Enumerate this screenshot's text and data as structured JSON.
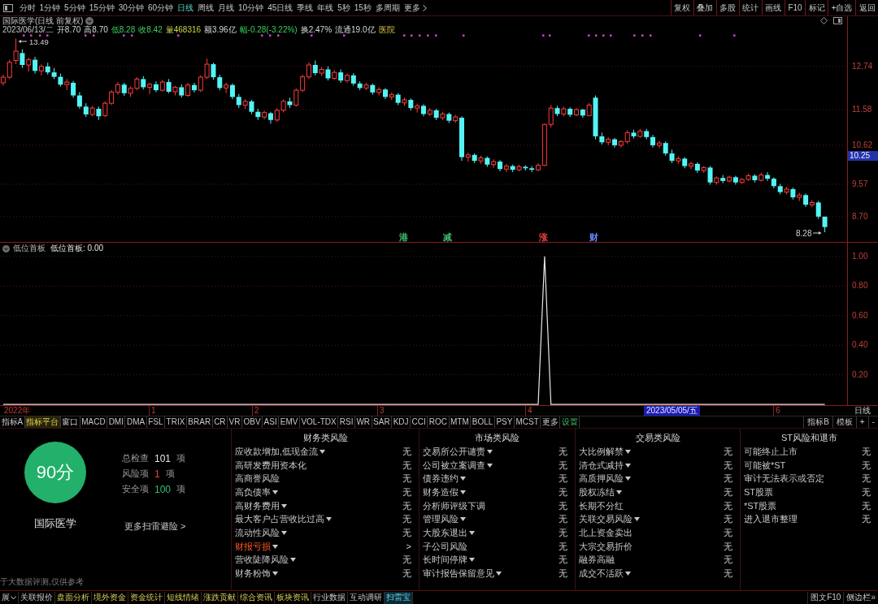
{
  "toolbar": {
    "periods": [
      {
        "label": "分时",
        "selected": false
      },
      {
        "label": "1分钟",
        "selected": false
      },
      {
        "label": "5分钟",
        "selected": false
      },
      {
        "label": "15分钟",
        "selected": false
      },
      {
        "label": "30分钟",
        "selected": false
      },
      {
        "label": "60分钟",
        "selected": false
      },
      {
        "label": "日线",
        "selected": true
      },
      {
        "label": "周线",
        "selected": false
      },
      {
        "label": "月线",
        "selected": false
      },
      {
        "label": "10分钟",
        "selected": false
      },
      {
        "label": "45日线",
        "selected": false
      },
      {
        "label": "季线",
        "selected": false
      },
      {
        "label": "年线",
        "selected": false
      },
      {
        "label": "5秒",
        "selected": false
      },
      {
        "label": "15秒",
        "selected": false
      },
      {
        "label": "多周期",
        "selected": false
      }
    ],
    "more": "更多",
    "actions": [
      "复权",
      "叠加",
      "多股",
      "统计",
      "画线",
      "F10",
      "标记",
      "+自选",
      "返回"
    ]
  },
  "quote": {
    "title": "国际医学(日线 前复权)",
    "date": "2023/06/13/二",
    "fields": [
      {
        "label": "开",
        "value": "8.70",
        "kind": "plain"
      },
      {
        "label": "高",
        "value": "8.70",
        "kind": "plain"
      },
      {
        "label": "低",
        "value": "8.28",
        "kind": "down"
      },
      {
        "label": "收",
        "value": "8.42",
        "kind": "down"
      },
      {
        "label": "量",
        "value": "468316",
        "kind": "volume"
      },
      {
        "label": "额",
        "value": "3.96亿",
        "kind": "plain"
      },
      {
        "label": "幅",
        "value": "-0.28(-3.22%)",
        "kind": "down"
      },
      {
        "label": "换",
        "value": "2.47%",
        "kind": "plain"
      },
      {
        "label": "流通",
        "value": "19.0亿",
        "kind": "plain"
      }
    ],
    "industry": "医院"
  },
  "price_chart": {
    "cursor_price": "10.25",
    "high_label": "13.49",
    "low_label": "8.28",
    "events": [
      {
        "label": "港",
        "color": "#3dbb6a"
      },
      {
        "label": "减",
        "color": "#3dbb6a"
      },
      {
        "label": "涨",
        "color": "#e84040"
      },
      {
        "label": "财",
        "color": "#6a8cff"
      }
    ],
    "chart_data": {
      "type": "candlestick",
      "grid": true,
      "ylim": [
        8.02,
        14.09
      ],
      "yticks": [
        {
          "value": 12.74,
          "label": "12.74"
        },
        {
          "value": 11.58,
          "label": "11.58"
        },
        {
          "value": 10.62,
          "label": "10.62"
        },
        {
          "value": 9.57,
          "label": "9.57"
        },
        {
          "value": 8.7,
          "label": "8.70"
        }
      ],
      "categories": [
        null,
        null,
        null,
        null,
        null,
        null,
        null,
        null,
        null,
        null,
        null,
        null,
        null,
        null,
        null,
        null,
        null,
        null,
        null,
        null,
        null,
        null,
        null,
        null,
        null,
        null,
        null,
        null,
        null,
        null,
        null,
        null,
        null,
        null,
        null,
        null,
        null,
        null,
        null,
        null,
        null,
        null,
        null,
        null,
        null,
        null,
        null,
        null,
        null,
        null,
        null,
        null,
        null,
        null,
        null,
        null,
        null,
        null,
        null,
        null,
        null,
        null,
        null,
        null,
        null,
        null,
        null,
        null,
        null,
        null,
        null,
        null,
        null,
        null,
        null,
        null,
        null,
        null,
        null,
        null,
        null,
        null,
        null,
        null,
        null,
        null,
        null,
        null,
        null,
        null,
        null,
        null,
        null,
        null,
        null,
        null,
        null,
        null,
        null,
        null,
        null,
        null,
        null,
        null,
        null,
        null,
        null,
        null,
        null,
        null,
        null,
        null,
        null,
        null,
        null,
        null,
        null,
        null,
        null,
        null,
        null,
        null,
        null,
        null,
        null,
        null,
        null,
        null,
        null,
        null,
        null,
        null,
        null
      ],
      "ohlc": [
        [
          12.3,
          12.52,
          12.22,
          12.45
        ],
        [
          12.45,
          12.92,
          12.4,
          12.85
        ],
        [
          12.9,
          13.49,
          12.8,
          13.15
        ],
        [
          13.1,
          13.2,
          12.7,
          12.78
        ],
        [
          12.78,
          12.98,
          12.6,
          12.92
        ],
        [
          12.92,
          13.0,
          12.55,
          12.62
        ],
        [
          12.62,
          12.8,
          12.5,
          12.74
        ],
        [
          12.74,
          12.84,
          12.52,
          12.58
        ],
        [
          12.58,
          12.7,
          12.4,
          12.46
        ],
        [
          12.46,
          12.55,
          12.2,
          12.25
        ],
        [
          12.25,
          12.4,
          12.1,
          12.32
        ],
        [
          12.3,
          12.35,
          11.9,
          11.96
        ],
        [
          11.96,
          12.05,
          11.6,
          11.66
        ],
        [
          11.66,
          11.75,
          11.38,
          11.45
        ],
        [
          11.45,
          11.68,
          11.4,
          11.62
        ],
        [
          11.6,
          11.66,
          11.3,
          11.4
        ],
        [
          11.42,
          11.8,
          11.38,
          11.75
        ],
        [
          11.75,
          12.1,
          11.7,
          12.05
        ],
        [
          12.05,
          12.32,
          11.98,
          12.25
        ],
        [
          12.25,
          12.3,
          11.95,
          12.02
        ],
        [
          12.02,
          12.2,
          11.92,
          12.15
        ],
        [
          12.15,
          12.45,
          12.1,
          12.4
        ],
        [
          12.4,
          12.48,
          12.12,
          12.18
        ],
        [
          12.18,
          12.3,
          12.0,
          12.26
        ],
        [
          12.26,
          12.34,
          12.05,
          12.1
        ],
        [
          12.1,
          12.38,
          12.06,
          12.32
        ],
        [
          12.32,
          12.4,
          12.02,
          12.06
        ],
        [
          12.06,
          12.22,
          11.96,
          12.18
        ],
        [
          12.18,
          12.26,
          11.9,
          11.96
        ],
        [
          11.96,
          12.3,
          11.92,
          12.24
        ],
        [
          12.24,
          12.3,
          12.04,
          12.1
        ],
        [
          12.1,
          12.5,
          12.05,
          12.45
        ],
        [
          12.45,
          12.95,
          12.4,
          12.8
        ],
        [
          12.8,
          12.84,
          12.38,
          12.45
        ],
        [
          12.45,
          12.52,
          12.1,
          12.16
        ],
        [
          12.16,
          12.3,
          12.02,
          12.24
        ],
        [
          12.24,
          12.28,
          11.86,
          11.92
        ],
        [
          11.92,
          12.0,
          11.62,
          11.7
        ],
        [
          11.7,
          11.86,
          11.6,
          11.8
        ],
        [
          11.8,
          11.84,
          11.46,
          11.52
        ],
        [
          11.52,
          11.6,
          11.3,
          11.38
        ],
        [
          11.38,
          11.55,
          11.32,
          11.5
        ],
        [
          11.48,
          11.52,
          11.2,
          11.3
        ],
        [
          11.3,
          11.62,
          11.25,
          11.56
        ],
        [
          11.56,
          11.85,
          11.5,
          11.8
        ],
        [
          11.8,
          11.9,
          11.62,
          11.7
        ],
        [
          11.7,
          12.15,
          11.66,
          12.1
        ],
        [
          12.1,
          12.52,
          12.05,
          12.46
        ],
        [
          12.46,
          12.85,
          12.4,
          12.78
        ],
        [
          12.78,
          12.9,
          12.5,
          12.56
        ],
        [
          12.56,
          12.72,
          12.48,
          12.66
        ],
        [
          12.66,
          12.74,
          12.36,
          12.42
        ],
        [
          12.42,
          12.64,
          12.38,
          12.58
        ],
        [
          12.58,
          12.66,
          12.3,
          12.36
        ],
        [
          12.36,
          12.55,
          12.3,
          12.5
        ],
        [
          12.5,
          12.56,
          12.22,
          12.28
        ],
        [
          12.28,
          12.34,
          12.1,
          12.16
        ],
        [
          12.16,
          12.3,
          12.1,
          12.24
        ],
        [
          12.24,
          12.28,
          11.98,
          12.04
        ],
        [
          12.04,
          12.18,
          11.96,
          12.12
        ],
        [
          12.12,
          12.16,
          11.86,
          11.92
        ],
        [
          11.92,
          12.04,
          11.84,
          11.98
        ],
        [
          11.98,
          12.02,
          11.7,
          11.76
        ],
        [
          11.76,
          11.9,
          11.68,
          11.84
        ],
        [
          11.84,
          11.88,
          11.56,
          11.62
        ],
        [
          11.62,
          11.74,
          11.5,
          11.68
        ],
        [
          11.68,
          11.72,
          11.4,
          11.46
        ],
        [
          11.46,
          11.62,
          11.4,
          11.56
        ],
        [
          11.56,
          11.6,
          11.3,
          11.36
        ],
        [
          11.36,
          11.52,
          11.3,
          11.46
        ],
        [
          11.46,
          11.5,
          11.22,
          11.28
        ],
        [
          11.28,
          11.44,
          11.22,
          11.38
        ],
        [
          11.36,
          11.4,
          10.2,
          10.3
        ],
        [
          10.3,
          10.42,
          10.18,
          10.36
        ],
        [
          10.36,
          10.4,
          10.14,
          10.2
        ],
        [
          10.2,
          10.34,
          10.12,
          10.28
        ],
        [
          10.28,
          10.32,
          10.04,
          10.1
        ],
        [
          10.1,
          10.24,
          10.02,
          10.18
        ],
        [
          10.18,
          10.22,
          9.92,
          9.98
        ],
        [
          9.98,
          10.12,
          9.9,
          10.06
        ],
        [
          10.06,
          10.1,
          9.9,
          9.96
        ],
        [
          9.96,
          10.1,
          9.92,
          10.04
        ],
        [
          10.04,
          10.08,
          9.94,
          10.0
        ],
        [
          10.0,
          10.06,
          9.9,
          9.96
        ],
        [
          9.96,
          10.14,
          9.92,
          10.08
        ],
        [
          10.08,
          11.2,
          10.06,
          11.18
        ],
        [
          11.18,
          11.7,
          11.1,
          11.62
        ],
        [
          11.62,
          11.68,
          11.4,
          11.46
        ],
        [
          11.46,
          11.66,
          11.4,
          11.6
        ],
        [
          11.6,
          11.64,
          11.38,
          11.44
        ],
        [
          11.44,
          11.62,
          11.4,
          11.58
        ],
        [
          11.58,
          11.6,
          11.36,
          11.42
        ],
        [
          11.42,
          11.76,
          11.4,
          11.7
        ],
        [
          11.9,
          11.96,
          10.78,
          10.86
        ],
        [
          10.86,
          10.96,
          10.64,
          10.7
        ],
        [
          10.7,
          10.84,
          10.62,
          10.78
        ],
        [
          10.78,
          10.82,
          10.56,
          10.62
        ],
        [
          10.62,
          10.76,
          10.56,
          10.72
        ],
        [
          10.72,
          11.02,
          10.66,
          10.96
        ],
        [
          10.96,
          11.04,
          10.8,
          10.86
        ],
        [
          10.86,
          11.06,
          10.82,
          11.0
        ],
        [
          11.0,
          11.06,
          10.78,
          10.84
        ],
        [
          10.84,
          10.9,
          10.56,
          10.62
        ],
        [
          10.62,
          10.74,
          10.54,
          10.68
        ],
        [
          10.68,
          10.72,
          10.34,
          10.4
        ],
        [
          10.4,
          10.5,
          10.14,
          10.2
        ],
        [
          10.2,
          10.32,
          10.12,
          10.26
        ],
        [
          10.26,
          10.3,
          10.0,
          10.06
        ],
        [
          10.06,
          10.18,
          9.98,
          10.12
        ],
        [
          10.12,
          10.16,
          9.88,
          9.94
        ],
        [
          9.94,
          10.06,
          9.88,
          10.02
        ],
        [
          10.02,
          10.06,
          9.56,
          9.62
        ],
        [
          9.62,
          9.78,
          9.56,
          9.74
        ],
        [
          9.74,
          9.82,
          9.6,
          9.66
        ],
        [
          9.66,
          9.8,
          9.62,
          9.76
        ],
        [
          9.76,
          9.8,
          9.56,
          9.62
        ],
        [
          9.62,
          9.74,
          9.58,
          9.7
        ],
        [
          9.7,
          9.86,
          9.66,
          9.8
        ],
        [
          9.8,
          9.84,
          9.62,
          9.68
        ],
        [
          9.68,
          9.88,
          9.64,
          9.82
        ],
        [
          9.82,
          9.9,
          9.66,
          9.72
        ],
        [
          9.72,
          9.76,
          9.46,
          9.52
        ],
        [
          9.52,
          9.58,
          9.3,
          9.36
        ],
        [
          9.36,
          9.5,
          9.3,
          9.44
        ],
        [
          9.44,
          9.48,
          9.16,
          9.22
        ],
        [
          9.22,
          9.34,
          9.12,
          9.28
        ],
        [
          9.28,
          9.32,
          8.96,
          9.02
        ],
        [
          9.02,
          9.14,
          8.96,
          9.08
        ],
        [
          9.08,
          9.12,
          8.64,
          8.7
        ],
        [
          8.7,
          8.7,
          8.28,
          8.42
        ],
        null,
        null,
        null
      ]
    }
  },
  "indicator": {
    "readout": "低位首板: 0.00",
    "chart_data": {
      "type": "line",
      "grid": true,
      "ylim": [
        -0.005,
        1.093
      ],
      "yticks": [
        {
          "value": 1,
          "label": "1.00"
        },
        {
          "value": 0.8,
          "label": "0.80"
        },
        {
          "value": 0.6,
          "label": "0.60"
        },
        {
          "value": 0.4,
          "label": "0.40"
        },
        {
          "value": 0.2,
          "label": "0.20"
        }
      ],
      "categories": [
        null,
        null,
        null,
        null,
        null,
        null,
        null,
        null,
        null,
        null,
        null,
        null,
        null,
        null,
        null,
        null,
        null,
        null,
        null,
        null,
        null,
        null,
        null,
        null,
        null,
        null,
        null,
        null,
        null,
        null,
        null,
        null,
        null,
        null,
        null,
        null,
        null,
        null,
        null,
        null,
        null,
        null,
        null,
        null,
        null,
        null,
        null,
        null,
        null,
        null,
        null,
        null,
        null,
        null,
        null,
        null,
        null,
        null,
        null,
        null,
        null,
        null,
        null,
        null,
        null,
        null,
        null,
        null,
        null,
        null,
        null,
        null,
        null,
        null,
        null,
        null,
        null,
        null,
        null,
        null,
        null,
        null,
        null,
        null,
        null,
        null,
        null,
        null,
        null,
        null,
        null,
        null,
        null,
        null,
        null,
        null,
        null,
        null,
        null,
        null,
        null,
        null,
        null,
        null,
        null,
        null,
        null,
        null,
        null,
        null,
        null,
        null,
        null,
        null,
        null,
        null,
        null,
        null,
        null,
        null,
        null,
        null,
        null,
        null,
        null,
        null,
        null,
        null,
        null,
        null,
        null,
        null,
        null
      ],
      "series": [
        {
          "name": "低位首板",
          "color": "#e6e6e6",
          "values": [
            0,
            0,
            0,
            0,
            0,
            0,
            0,
            0,
            0,
            0,
            0,
            0,
            0,
            0,
            0,
            0,
            0,
            0,
            0,
            0,
            0,
            0,
            0,
            0,
            0,
            0,
            0,
            0,
            0,
            0,
            0,
            0,
            0,
            0,
            0,
            0,
            0,
            0,
            0,
            0,
            0,
            0,
            0,
            0,
            0,
            0,
            0,
            0,
            0,
            0,
            0,
            0,
            0,
            0,
            0,
            0,
            0,
            0,
            0,
            0,
            0,
            0,
            0,
            0,
            0,
            0,
            0,
            0,
            0,
            0,
            0,
            0,
            0,
            0,
            0,
            0,
            0,
            0,
            0,
            0,
            0,
            0,
            0,
            0,
            0,
            1,
            0,
            0,
            0,
            0,
            0,
            0,
            0,
            0,
            0,
            0,
            0,
            0,
            0,
            0,
            0,
            0,
            0,
            0,
            0,
            0,
            0,
            0,
            0,
            0,
            0,
            0,
            0,
            0,
            0,
            0,
            0,
            0,
            0,
            0,
            0,
            0,
            0,
            0,
            0,
            0,
            0,
            0,
            0,
            0,
            null,
            null,
            null
          ]
        }
      ]
    }
  },
  "date_axis": {
    "labels": [
      "2022年",
      "1",
      "2",
      "3",
      "4",
      "6"
    ],
    "cursor_date": "2023/05/05/五",
    "period": "日线"
  },
  "indicator_tabs": {
    "items": [
      {
        "label": "指标A",
        "selected": false,
        "kind": "tab"
      },
      {
        "label": "指标平台",
        "selected": true,
        "kind": "tab"
      },
      {
        "label": "窗口",
        "selected": false,
        "kind": "tab"
      },
      {
        "label": "MACD",
        "selected": false,
        "kind": "tab"
      },
      {
        "label": "DMI",
        "selected": false,
        "kind": "tab"
      },
      {
        "label": "DMA",
        "selected": false,
        "kind": "tab"
      },
      {
        "label": "FSL",
        "selected": false,
        "kind": "tab"
      },
      {
        "label": "TRIX",
        "selected": false,
        "kind": "tab"
      },
      {
        "label": "BRAR",
        "selected": false,
        "kind": "tab"
      },
      {
        "label": "CR",
        "selected": false,
        "kind": "tab"
      },
      {
        "label": "VR",
        "selected": false,
        "kind": "tab"
      },
      {
        "label": "OBV",
        "selected": false,
        "kind": "tab"
      },
      {
        "label": "ASI",
        "selected": false,
        "kind": "tab"
      },
      {
        "label": "EMV",
        "selected": false,
        "kind": "tab"
      },
      {
        "label": "VOL-TDX",
        "selected": false,
        "kind": "tab"
      },
      {
        "label": "RSI",
        "selected": false,
        "kind": "tab"
      },
      {
        "label": "WR",
        "selected": false,
        "kind": "tab"
      },
      {
        "label": "SAR",
        "selected": false,
        "kind": "tab"
      },
      {
        "label": "KDJ",
        "selected": false,
        "kind": "tab"
      },
      {
        "label": "CCI",
        "selected": false,
        "kind": "tab"
      },
      {
        "label": "ROC",
        "selected": false,
        "kind": "tab"
      },
      {
        "label": "MTM",
        "selected": false,
        "kind": "tab"
      },
      {
        "label": "BOLL",
        "selected": false,
        "kind": "tab"
      },
      {
        "label": "PSY",
        "selected": false,
        "kind": "tab"
      },
      {
        "label": "MCST",
        "selected": false,
        "kind": "tab"
      },
      {
        "label": "更多",
        "selected": false,
        "kind": "tab"
      },
      {
        "label": "设置",
        "selected": false,
        "kind": "action"
      }
    ],
    "right": [
      "指标B",
      "模板",
      "+",
      "-"
    ]
  },
  "scan": {
    "score": "90分",
    "stock": "国际医学",
    "stats": [
      {
        "label": "总检查",
        "value": "101",
        "unit": "项",
        "kind": "total"
      },
      {
        "label": "风险项",
        "value": "1",
        "unit": "项",
        "kind": "risk"
      },
      {
        "label": "安全项",
        "value": "100",
        "unit": "项",
        "kind": "safe"
      }
    ],
    "more_link": "更多扫雷避险 >",
    "disclaimer": "于大数据评测,仅供参考",
    "categories": [
      {
        "title": "财务类风险",
        "items": [
          {
            "label": "应收款增加,低现金流",
            "dropdown": true,
            "alert": false,
            "result": "无"
          },
          {
            "label": "高研发费用资本化",
            "dropdown": false,
            "alert": false,
            "result": "无"
          },
          {
            "label": "高商誉风险",
            "dropdown": false,
            "alert": false,
            "result": "无"
          },
          {
            "label": "高负债率",
            "dropdown": true,
            "alert": false,
            "result": "无"
          },
          {
            "label": "高财务费用",
            "dropdown": true,
            "alert": false,
            "result": "无"
          },
          {
            "label": "最大客户占营收比过高",
            "dropdown": true,
            "alert": false,
            "result": "无"
          },
          {
            "label": "流动性风险",
            "dropdown": true,
            "alert": false,
            "result": "无"
          },
          {
            "label": "财报亏损",
            "dropdown": true,
            "alert": true,
            "result": ">"
          },
          {
            "label": "营收陡降风险",
            "dropdown": true,
            "alert": false,
            "result": "无"
          },
          {
            "label": "财务粉饰",
            "dropdown": true,
            "alert": false,
            "result": "无"
          }
        ]
      },
      {
        "title": "市场类风险",
        "items": [
          {
            "label": "交易所公开谴责",
            "dropdown": true,
            "alert": false,
            "result": "无"
          },
          {
            "label": "公司被立案调查",
            "dropdown": true,
            "alert": false,
            "result": "无"
          },
          {
            "label": "债券违约",
            "dropdown": true,
            "alert": false,
            "result": "无"
          },
          {
            "label": "财务造假",
            "dropdown": true,
            "alert": false,
            "result": "无"
          },
          {
            "label": "分析师评级下调",
            "dropdown": false,
            "alert": false,
            "result": "无"
          },
          {
            "label": "管理风险",
            "dropdown": true,
            "alert": false,
            "result": "无"
          },
          {
            "label": "大股东退出",
            "dropdown": true,
            "alert": false,
            "result": "无"
          },
          {
            "label": "子公司风险",
            "dropdown": false,
            "alert": false,
            "result": "无"
          },
          {
            "label": "长时间停牌",
            "dropdown": true,
            "alert": false,
            "result": "无"
          },
          {
            "label": "审计报告保留意见",
            "dropdown": true,
            "alert": false,
            "result": "无"
          }
        ]
      },
      {
        "title": "交易类风险",
        "items": [
          {
            "label": "大比例解禁",
            "dropdown": true,
            "alert": false,
            "result": "无"
          },
          {
            "label": "清仓式减持",
            "dropdown": true,
            "alert": false,
            "result": "无"
          },
          {
            "label": "高质押风险",
            "dropdown": true,
            "alert": false,
            "result": "无"
          },
          {
            "label": "股权冻结",
            "dropdown": true,
            "alert": false,
            "result": "无"
          },
          {
            "label": "长期不分红",
            "dropdown": false,
            "alert": false,
            "result": "无"
          },
          {
            "label": "关联交易风险",
            "dropdown": true,
            "alert": false,
            "result": "无"
          },
          {
            "label": "北上资金卖出",
            "dropdown": false,
            "alert": false,
            "result": "无"
          },
          {
            "label": "大宗交易折价",
            "dropdown": false,
            "alert": false,
            "result": "无"
          },
          {
            "label": "融券高融",
            "dropdown": false,
            "alert": false,
            "result": "无"
          },
          {
            "label": "成交不活跃",
            "dropdown": true,
            "alert": false,
            "result": "无"
          }
        ]
      },
      {
        "title": "ST风险和退市",
        "items": [
          {
            "label": "可能终止上市",
            "dropdown": false,
            "alert": false,
            "result": "无"
          },
          {
            "label": "可能被*ST",
            "dropdown": false,
            "alert": false,
            "result": "无"
          },
          {
            "label": "审计无法表示或否定",
            "dropdown": false,
            "alert": false,
            "result": "无"
          },
          {
            "label": "ST股票",
            "dropdown": false,
            "alert": false,
            "result": "无"
          },
          {
            "label": "*ST股票",
            "dropdown": false,
            "alert": false,
            "result": "无"
          },
          {
            "label": "进入退市整理",
            "dropdown": false,
            "alert": false,
            "result": "无"
          }
        ]
      }
    ]
  },
  "bottom_tabs": {
    "items": [
      {
        "label": "展",
        "kind": "menu",
        "selected": false
      },
      {
        "label": "关联报价",
        "kind": "tab",
        "selected": false
      },
      {
        "label": "盘面分析",
        "kind": "plugin",
        "selected": false
      },
      {
        "label": "境外资金",
        "kind": "plugin",
        "selected": false
      },
      {
        "label": "资金统计",
        "kind": "plugin",
        "selected": false
      },
      {
        "label": "短线情绪",
        "kind": "plugin",
        "selected": false
      },
      {
        "label": "涨跌贡献",
        "kind": "plugin",
        "selected": false
      },
      {
        "label": "综合资讯",
        "kind": "plugin",
        "selected": false
      },
      {
        "label": "板块资讯",
        "kind": "plugin",
        "selected": false
      },
      {
        "label": "行业数据",
        "kind": "tab",
        "selected": false
      },
      {
        "label": "互动调研",
        "kind": "tab",
        "selected": false
      },
      {
        "label": "扫雷宝",
        "kind": "plugin",
        "selected": true
      }
    ],
    "right": [
      "图文F10",
      "侧边栏»"
    ]
  }
}
